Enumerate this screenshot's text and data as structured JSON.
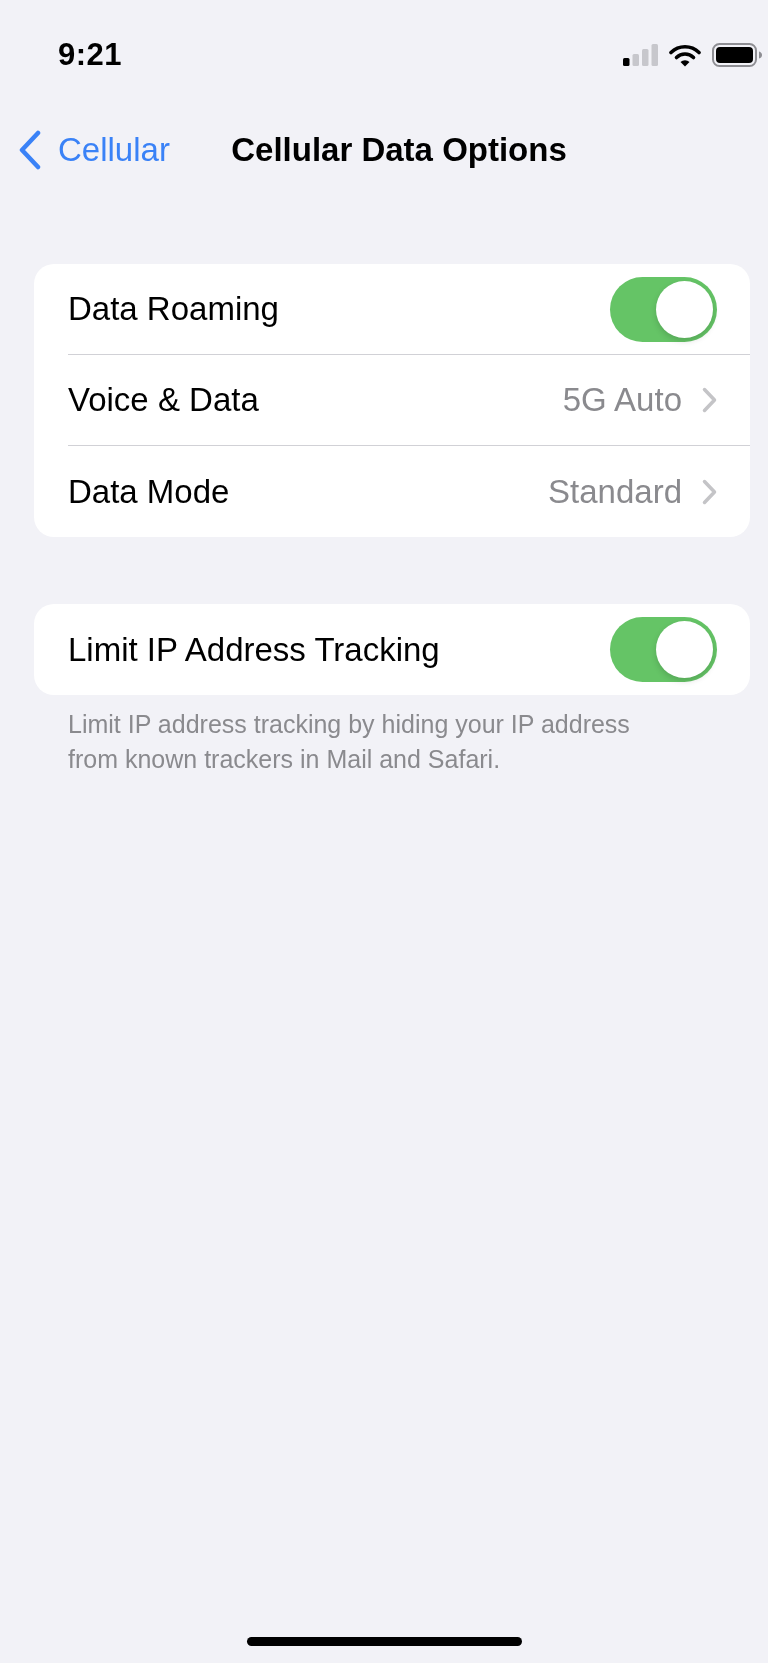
{
  "status_bar": {
    "time": "9:21"
  },
  "nav": {
    "back_label": "Cellular",
    "title": "Cellular Data Options"
  },
  "groups": [
    {
      "rows": [
        {
          "kind": "toggle",
          "label": "Data Roaming",
          "on": true
        },
        {
          "kind": "link",
          "label": "Voice & Data",
          "value": "5G Auto"
        },
        {
          "kind": "link",
          "label": "Data Mode",
          "value": "Standard"
        }
      ]
    },
    {
      "rows": [
        {
          "kind": "toggle",
          "label": "Limit IP Address Tracking",
          "on": true
        }
      ],
      "footer": "Limit IP address tracking by hiding your IP address from known trackers in Mail and Safari."
    }
  ]
}
